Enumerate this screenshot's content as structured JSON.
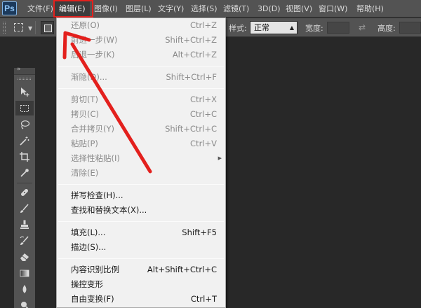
{
  "app": {
    "logo": "Ps"
  },
  "menubar": {
    "items": [
      "文件(F)",
      "编辑(E)",
      "图像(I)",
      "图层(L)",
      "文字(Y)",
      "选择(S)",
      "滤镜(T)",
      "3D(D)",
      "视图(V)",
      "窗口(W)",
      "帮助(H)"
    ],
    "active_index": 1
  },
  "options_bar": {
    "style_label": "样式:",
    "style_value": "正常",
    "width_label": "宽度:",
    "height_label": "高度:"
  },
  "icons": {
    "marquee": "rect-marquee-icon",
    "move": "move-icon",
    "lasso": "lasso-icon",
    "magic_wand": "magic-wand-icon",
    "crop": "crop-icon",
    "eyedropper": "eyedropper-icon",
    "healing": "healing-brush-icon",
    "brush": "brush-icon",
    "stamp": "clone-stamp-icon",
    "history_brush": "history-brush-icon",
    "eraser": "eraser-icon",
    "gradient": "gradient-icon",
    "blur": "blur-icon",
    "dodge": "dodge-icon"
  },
  "edit_menu": {
    "groups": [
      [
        {
          "label": "还原(O)",
          "shortcut": "Ctrl+Z",
          "enabled": false
        },
        {
          "label": "前进一步(W)",
          "shortcut": "Shift+Ctrl+Z",
          "enabled": false
        },
        {
          "label": "后退一步(K)",
          "shortcut": "Alt+Ctrl+Z",
          "enabled": false
        }
      ],
      [
        {
          "label": "渐隐(D)...",
          "shortcut": "Shift+Ctrl+F",
          "enabled": false
        }
      ],
      [
        {
          "label": "剪切(T)",
          "shortcut": "Ctrl+X",
          "enabled": false
        },
        {
          "label": "拷贝(C)",
          "shortcut": "Ctrl+C",
          "enabled": false
        },
        {
          "label": "合并拷贝(Y)",
          "shortcut": "Shift+Ctrl+C",
          "enabled": false
        },
        {
          "label": "粘贴(P)",
          "shortcut": "Ctrl+V",
          "enabled": false
        },
        {
          "label": "选择性粘贴(I)",
          "shortcut": "",
          "enabled": false,
          "submenu": true
        },
        {
          "label": "清除(E)",
          "shortcut": "",
          "enabled": false
        }
      ],
      [
        {
          "label": "拼写检查(H)...",
          "shortcut": "",
          "enabled": true
        },
        {
          "label": "查找和替换文本(X)...",
          "shortcut": "",
          "enabled": true
        }
      ],
      [
        {
          "label": "填充(L)...",
          "shortcut": "Shift+F5",
          "enabled": true
        },
        {
          "label": "描边(S)...",
          "shortcut": "",
          "enabled": true
        }
      ],
      [
        {
          "label": "内容识别比例",
          "shortcut": "Alt+Shift+Ctrl+C",
          "enabled": true
        },
        {
          "label": "操控变形",
          "shortcut": "",
          "enabled": true
        },
        {
          "label": "自由变换(F)",
          "shortcut": "Ctrl+T",
          "enabled": true
        }
      ]
    ]
  },
  "annotation": {
    "color": "#e3201d"
  }
}
